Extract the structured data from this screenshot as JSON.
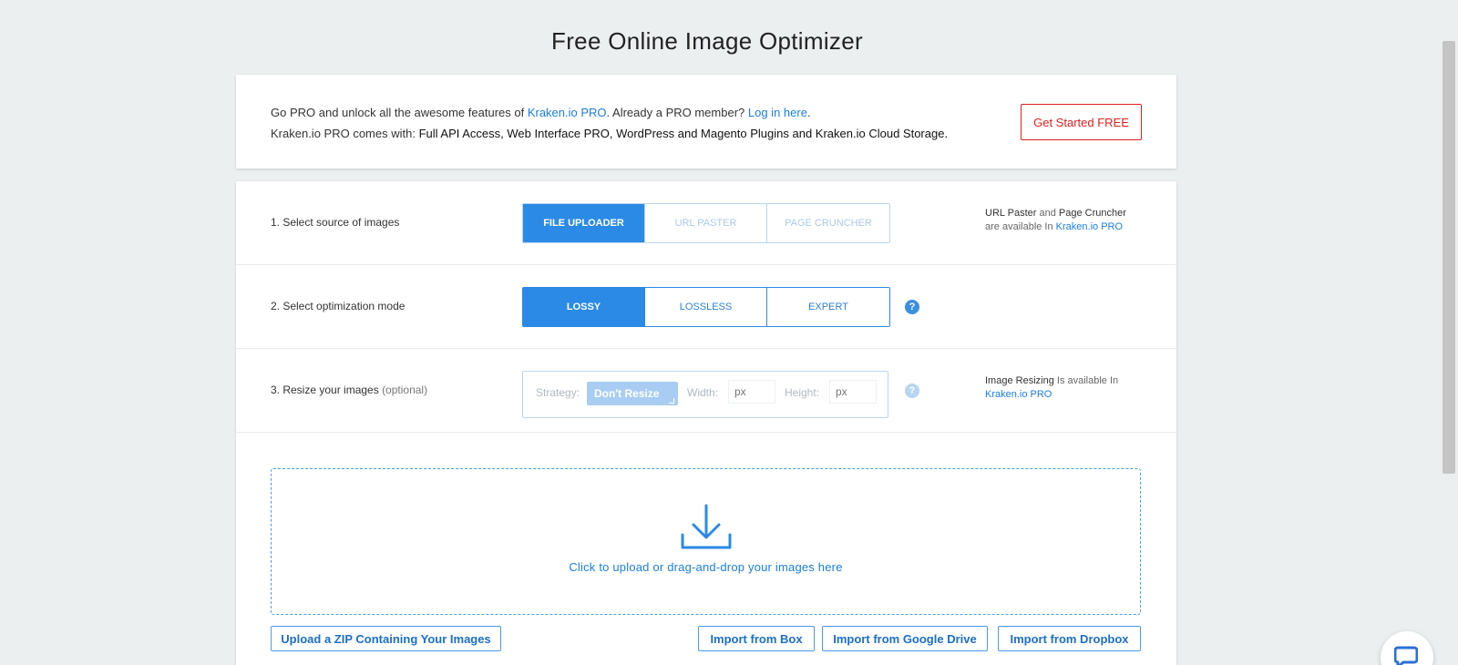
{
  "page": {
    "title": "Free Online Image Optimizer"
  },
  "promo": {
    "line1_prefix": "Go PRO and unlock all the awesome features of ",
    "line1_link": "Kraken.io PRO",
    "line1_middle": ". Already a PRO member? ",
    "line1_login": "Log in here",
    "line1_end": ".",
    "line2_prefix": "Kraken.io PRO comes with: ",
    "line2_features": "Full API Access, Web Interface PRO, WordPress and Magento Plugins and Kraken.io Cloud Storage.",
    "cta_label": "Get Started FREE"
  },
  "steps": {
    "source": {
      "label": "1. Select source of images",
      "options": [
        "FILE UPLOADER",
        "URL PASTER",
        "PAGE CRUNCHER"
      ],
      "selected": "FILE UPLOADER",
      "note_b1": "URL Paster",
      "note_t1": " and ",
      "note_b2": "Page Cruncher",
      "note_t2": "are available In ",
      "note_link": "Kraken.io PRO"
    },
    "mode": {
      "label": "2. Select optimization mode",
      "options": [
        "LOSSY",
        "LOSSLESS",
        "EXPERT"
      ],
      "selected": "LOSSY",
      "help": "?"
    },
    "resize": {
      "label": "3. Resize your images",
      "label_optional": "(optional)",
      "strategy_label": "Strategy:",
      "strategy_value": "Don't Resize",
      "width_label": "Width:",
      "width_placeholder": "px",
      "height_label": "Height:",
      "height_placeholder": "px",
      "help": "?",
      "note_b": "Image Resizing",
      "note_t": " Is available In",
      "note_link": "Kraken.io PRO"
    }
  },
  "upload": {
    "dropzone_text": "Click to upload or drag-and-drop your images here",
    "zip_button": "Upload a ZIP Containing Your Images",
    "import_box": "Import from Box",
    "import_gdrive": "Import from Google Drive",
    "import_dropbox": "Import from Dropbox"
  },
  "colors": {
    "accent": "#2b8ae6",
    "cta": "#e0201e",
    "background": "#eceff0"
  }
}
